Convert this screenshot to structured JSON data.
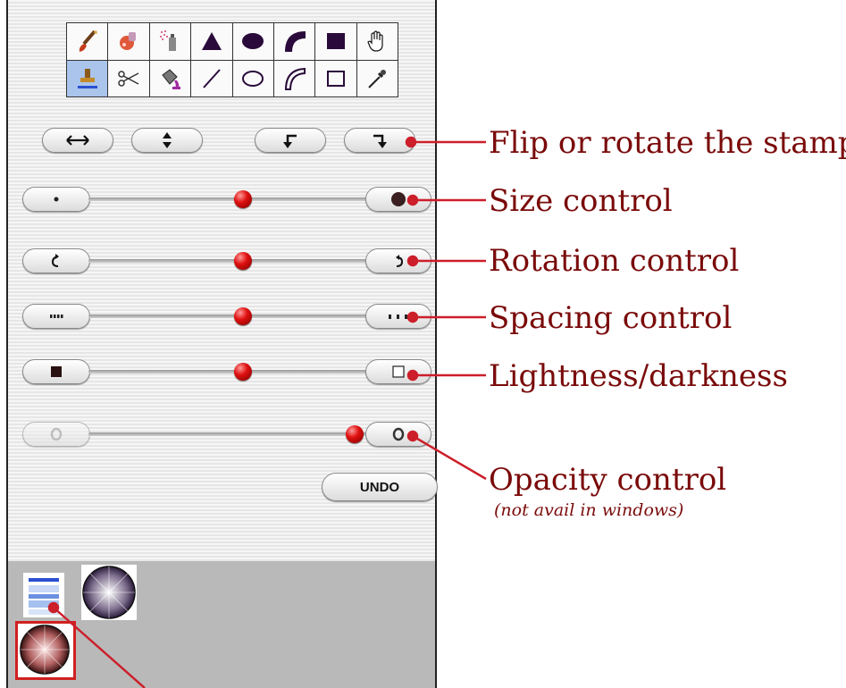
{
  "tools": {
    "row1": [
      "brush-icon",
      "airbrush-icon",
      "spray-can-icon",
      "triangle-icon",
      "ellipse-fill-icon",
      "arc-icon",
      "square-fill-icon",
      "hand-icon"
    ],
    "row2": [
      "stamp-icon",
      "scissors-icon",
      "paint-bucket-icon",
      "line-icon",
      "ellipse-outline-icon",
      "curve-icon",
      "square-outline-icon",
      "eyedropper-icon"
    ],
    "selected": "stamp-icon"
  },
  "buttons": {
    "flip_horizontal": "flip-horizontal-icon",
    "flip_vertical": "flip-vertical-icon",
    "rotate_left": "rotate-left-icon",
    "rotate_right": "rotate-right-icon",
    "undo_label": "UNDO"
  },
  "sliders": [
    {
      "name": "size",
      "value": 0.55
    },
    {
      "name": "rotation",
      "value": 0.55
    },
    {
      "name": "spacing",
      "value": 0.55
    },
    {
      "name": "lightness",
      "value": 0.55
    },
    {
      "name": "opacity",
      "value": 1.0
    }
  ],
  "callouts": {
    "flip": "Flip or rotate the stamp",
    "size": "Size control",
    "rotation": "Rotation control",
    "spacing": "Spacing control",
    "lightness": "Lightness/darkness",
    "opacity": "Opacity control",
    "opacity_note": "(not avail in windows)"
  },
  "colors": {
    "callout_text": "#7a0a0a",
    "callout_line": "#cc1f2a",
    "selected_tool": "#aac4ec",
    "knob": "#e01010"
  }
}
